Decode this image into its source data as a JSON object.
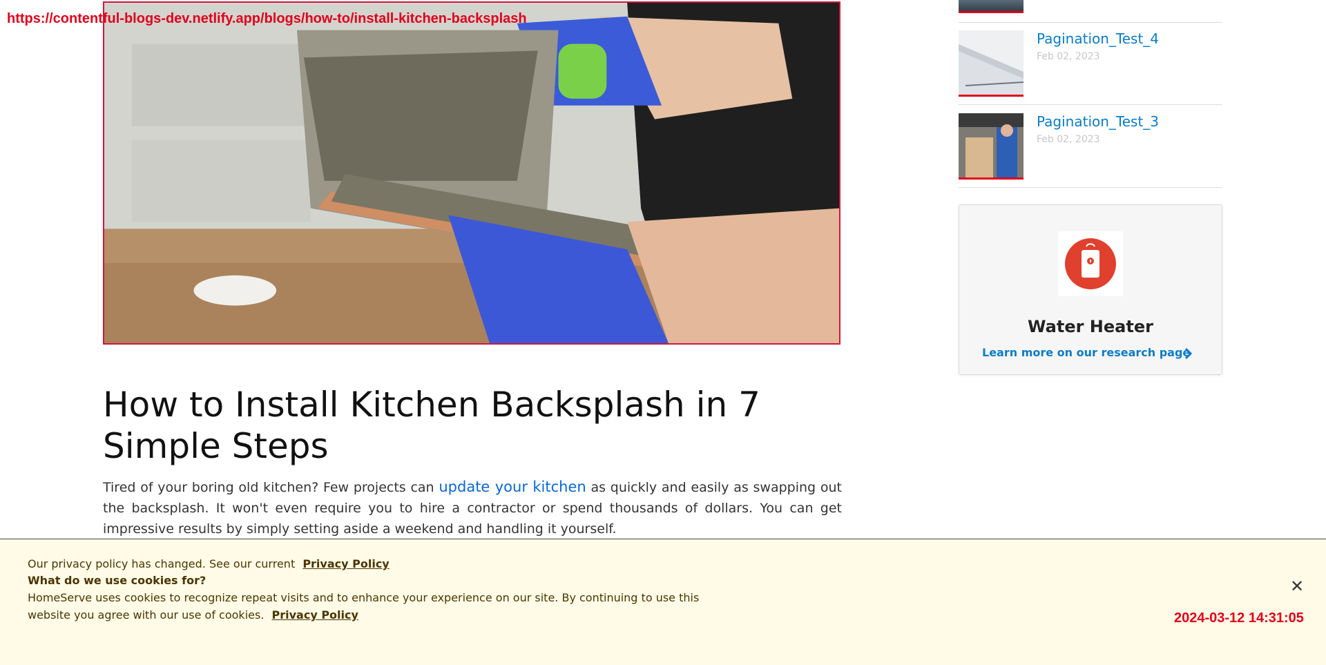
{
  "overlay": {
    "url": "https://contentful-blogs-dev.netlify.app/blogs/how-to/install-kitchen-backsplash",
    "timestamp": "2024-03-12 14:31:05"
  },
  "article": {
    "title": "How to Install Kitchen Backsplash in 7 Simple Steps",
    "intro_before": "Tired of your boring old kitchen? Few projects can ",
    "intro_link": "update your kitchen",
    "intro_after": " as quickly and easily as swapping out the backsplash. It won't even require you to hire a contractor or spend thousands of dollars. You can get impressive results by simply setting aside a weekend and handling it yourself."
  },
  "sidebar": {
    "posts": [
      {
        "title": "Pagination_Test_4",
        "date": "Feb 02, 2023"
      },
      {
        "title": "Pagination_Test_3",
        "date": "Feb 02, 2023"
      }
    ],
    "card": {
      "title": "Water Heater",
      "link": "Learn more on our research page"
    }
  },
  "cookie": {
    "line1": "Our privacy policy has changed. See our current",
    "line1_link": "Privacy Policy",
    "heading": "What do we use cookies for?",
    "body": "HomeServe uses cookies to recognize repeat visits and to enhance your experience on our site. By continuing to use this website you agree with our use of cookies.",
    "body_link": "Privacy Policy",
    "close_glyph": "✕"
  },
  "colors": {
    "accent_red": "#e0001b",
    "link_blue": "#0b7cc4",
    "cookie_bg": "#fffbe7"
  }
}
